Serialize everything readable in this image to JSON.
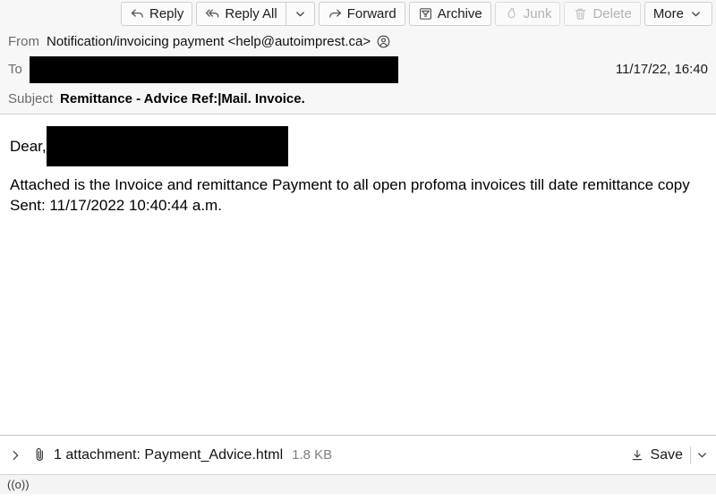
{
  "toolbar": {
    "buttons": [
      {
        "label": "Reply",
        "icon": "reply-icon",
        "disabled": false
      },
      {
        "label": "Reply All",
        "icon": "reply-all-icon",
        "disabled": false
      },
      {
        "label": "Forward",
        "icon": "forward-icon",
        "disabled": false
      },
      {
        "label": "Archive",
        "icon": "archive-icon",
        "disabled": false
      },
      {
        "label": "Junk",
        "icon": "junk-flame-icon",
        "disabled": true
      },
      {
        "label": "Delete",
        "icon": "trash-icon",
        "disabled": true
      },
      {
        "label": "More",
        "icon": "chevron-down-icon",
        "disabled": false
      }
    ]
  },
  "headers": {
    "from_label": "From",
    "from_value": "Notification/invoicing payment <help@autoimprest.ca>",
    "from_contact_icon": "contact-circle-icon",
    "to_label": "To",
    "to_value_redacted": true,
    "timestamp": "11/17/22, 16:40",
    "subject_label": "Subject",
    "subject_value": "Remittance - Advice Ref:|Mail. Invoice."
  },
  "body": {
    "greeting": "Dear,",
    "greeting_name_redacted": true,
    "paragraph": "Attached is the Invoice and remittance Payment to all open profoma invoices till date remittance copy Sent: 11/17/2022 10:40:44 a.m."
  },
  "attachment": {
    "expander_icon": "chevron-right-icon",
    "clip_icon": "paperclip-icon",
    "label": "1 attachment: Payment_Advice.html",
    "size": "1.8 KB",
    "save_label": "Save",
    "save_icon": "download-icon",
    "save_dropdown_icon": "chevron-down-icon"
  },
  "statusbar": {
    "icon": "broadcast-signal-icon",
    "glyph": "((o))"
  },
  "colors": {
    "toolbar_bg": "#f7f7f7",
    "header_bg": "#f7f7f7",
    "body_bg": "#ffffff",
    "redaction": "#000000",
    "disabled_text": "#b2b2b2",
    "muted_text": "#6b6b6b"
  }
}
